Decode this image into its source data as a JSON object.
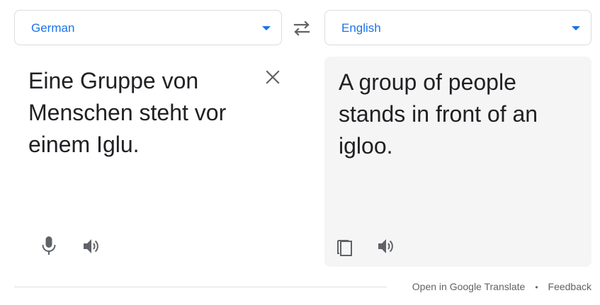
{
  "languages": {
    "source": "German",
    "target": "English"
  },
  "source": {
    "text": "Eine Gruppe von Menschen steht vor einem Iglu."
  },
  "translation": {
    "text": "A group of people stands in front of an igloo."
  },
  "footer": {
    "open_link": "Open in Google Translate",
    "separator": "•",
    "feedback_link": "Feedback"
  },
  "colors": {
    "accent": "#1a73e8",
    "icon": "#5f6368",
    "text": "#202124",
    "target_background": "#f5f5f5"
  },
  "icons": {
    "swap": "swap-icon",
    "clear": "close-icon",
    "mic": "microphone-icon",
    "speaker": "speaker-icon",
    "copy": "copy-icon",
    "dropdown": "chevron-down-icon"
  }
}
